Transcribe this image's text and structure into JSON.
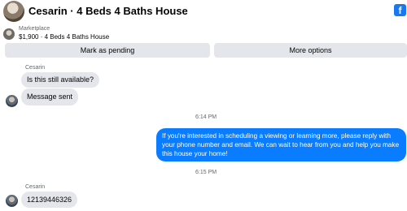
{
  "header": {
    "title": "Cesarin · 4 Beds 4 Baths House",
    "badge_glyph": "f",
    "accent": "#1877f2"
  },
  "marketplace": {
    "label": "Marketplace",
    "detail": "$1,900 · 4 Beds 4 Baths House"
  },
  "actions": {
    "mark_pending": "Mark as pending",
    "more_options": "More options"
  },
  "messages": [
    {
      "sender": "Cesarin",
      "text": "Is this still available?"
    },
    {
      "text": "Message sent"
    }
  ],
  "timestamps": [
    "6:14 PM",
    "6:15 PM"
  ],
  "outgoing": {
    "text": "If you're interested in scheduling a viewing or learning more, please reply with your phone number and email. We can  wait to hear from you and help you make this house your home!",
    "color": "#0a7cff"
  },
  "last_message": {
    "sender": "Cesarin",
    "text": "12139446326"
  }
}
